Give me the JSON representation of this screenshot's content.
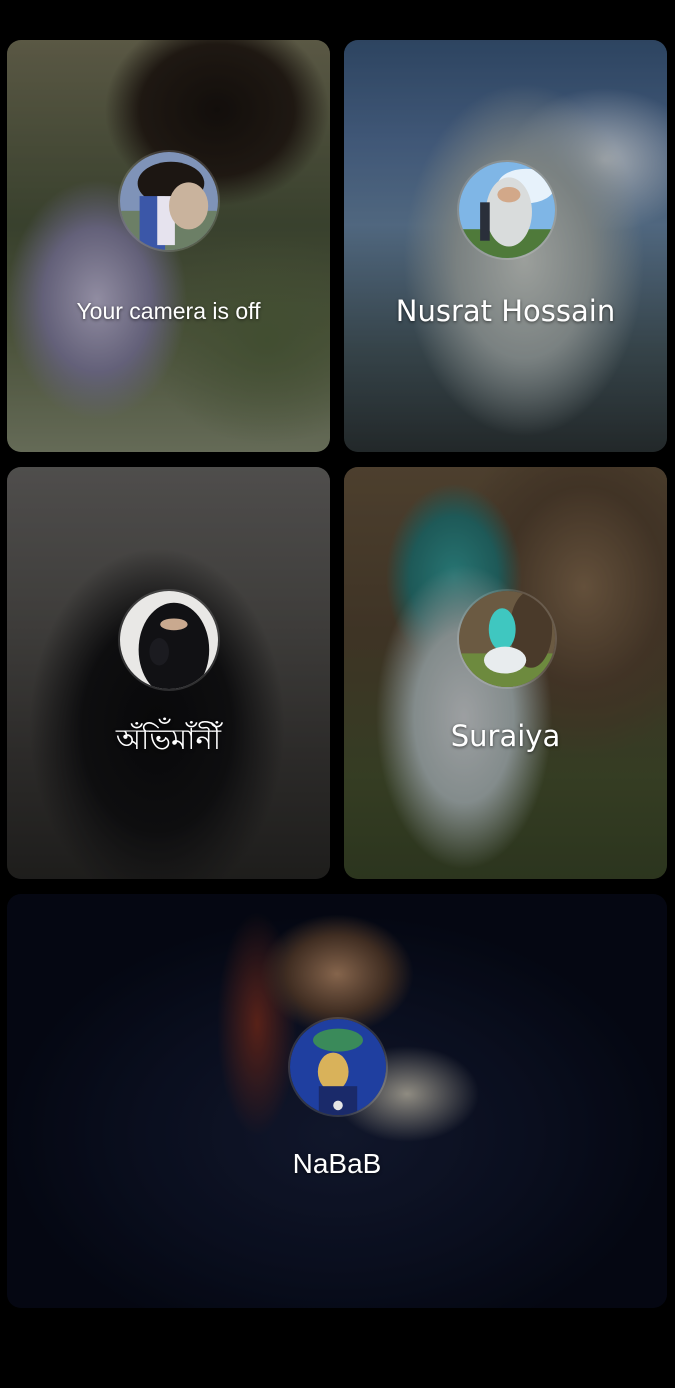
{
  "participants": [
    {
      "name": "Your camera is off",
      "avatar_icon": "user-avatar-icon"
    },
    {
      "name": "Nusrat Hossain",
      "avatar_icon": "user-avatar-icon"
    },
    {
      "name": "অঁভিঁমাঁনীঁ",
      "avatar_icon": "user-avatar-icon"
    },
    {
      "name": "Suraiya",
      "avatar_icon": "user-avatar-icon"
    },
    {
      "name": "NaBaB",
      "avatar_icon": "user-avatar-icon"
    }
  ],
  "colors": {
    "background": "#000000",
    "label_text": "#ffffff"
  }
}
